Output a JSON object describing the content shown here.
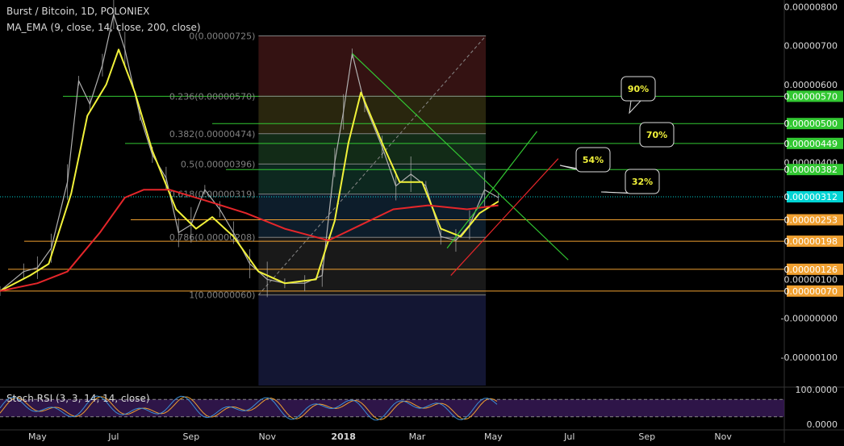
{
  "header": {
    "title": "Burst / Bitcoin, 1D, POLONIEX",
    "indicator": "MA_EMA (9, close, 14, close, 200, close)"
  },
  "rsi_label": "Stoch RSI (3, 3, 14, 14, close)",
  "colors": {
    "price": "#b0b0b0",
    "ema_fast": "#f2f23a",
    "ema_slow": "#e5262a",
    "fib_line": "#808080",
    "fib_text": "#808080",
    "price_tag": "#00d4d4",
    "green_level": "#32c832",
    "orange_level": "#f0a030",
    "callout_text": "#f2f23a",
    "rsi_k": "#3a8fd8",
    "rsi_d": "#f0a030",
    "rsi_band": "#3a1a5a"
  },
  "chart_data": {
    "type": "line",
    "title": "Burst / Bitcoin, 1D, POLONIEX",
    "x_axis_labels": [
      "May",
      "Jul",
      "Sep",
      "Nov",
      "2018",
      "Mar",
      "May",
      "Jul",
      "Sep",
      "Nov"
    ],
    "y_axis_labels": [
      "0.00000800",
      "0.00000700",
      "0.00000600",
      "0.00000400",
      "0.00000100",
      "-0.00000000",
      "-0.00000100"
    ],
    "ylim": [
      -1e-06,
      8.8e-06
    ],
    "last_price": "0.00000312",
    "price_series": [
      {
        "t": "2017-04-01",
        "v": 7e-07
      },
      {
        "t": "2017-04-20",
        "v": 1.2e-06
      },
      {
        "t": "2017-05-01",
        "v": 1.3e-06
      },
      {
        "t": "2017-05-12",
        "v": 1.8e-06
      },
      {
        "t": "2017-05-25",
        "v": 3.5e-06
      },
      {
        "t": "2017-06-03",
        "v": 6.1e-06
      },
      {
        "t": "2017-06-12",
        "v": 5.5e-06
      },
      {
        "t": "2017-06-22",
        "v": 6.5e-06
      },
      {
        "t": "2017-07-01",
        "v": 7.8e-06
      },
      {
        "t": "2017-07-10",
        "v": 6.9e-06
      },
      {
        "t": "2017-07-22",
        "v": 5.2e-06
      },
      {
        "t": "2017-08-01",
        "v": 4.2e-06
      },
      {
        "t": "2017-08-12",
        "v": 3.6e-06
      },
      {
        "t": "2017-08-22",
        "v": 2.2e-06
      },
      {
        "t": "2017-09-01",
        "v": 2.4e-06
      },
      {
        "t": "2017-09-12",
        "v": 3.3e-06
      },
      {
        "t": "2017-09-24",
        "v": 2.8e-06
      },
      {
        "t": "2017-10-05",
        "v": 2.2e-06
      },
      {
        "t": "2017-10-18",
        "v": 1.4e-06
      },
      {
        "t": "2017-11-01",
        "v": 1e-06
      },
      {
        "t": "2017-11-15",
        "v": 9e-07
      },
      {
        "t": "2017-12-01",
        "v": 9e-07
      },
      {
        "t": "2017-12-15",
        "v": 1.1e-06
      },
      {
        "t": "2017-12-25",
        "v": 4e-06
      },
      {
        "t": "2018-01-01",
        "v": 5.3e-06
      },
      {
        "t": "2018-01-08",
        "v": 6.8e-06
      },
      {
        "t": "2018-01-18",
        "v": 5.5e-06
      },
      {
        "t": "2018-02-01",
        "v": 4.4e-06
      },
      {
        "t": "2018-02-12",
        "v": 3.4e-06
      },
      {
        "t": "2018-02-24",
        "v": 3.7e-06
      },
      {
        "t": "2018-03-08",
        "v": 3.4e-06
      },
      {
        "t": "2018-03-20",
        "v": 2.1e-06
      },
      {
        "t": "2018-04-01",
        "v": 2e-06
      },
      {
        "t": "2018-04-12",
        "v": 2.4e-06
      },
      {
        "t": "2018-04-24",
        "v": 3.3e-06
      },
      {
        "t": "2018-05-05",
        "v": 3.1e-06
      }
    ],
    "ema_fast": [
      {
        "t": "2017-04-01",
        "v": 7e-07
      },
      {
        "t": "2017-04-25",
        "v": 1.1e-06
      },
      {
        "t": "2017-05-10",
        "v": 1.4e-06
      },
      {
        "t": "2017-05-28",
        "v": 3.2e-06
      },
      {
        "t": "2017-06-10",
        "v": 5.2e-06
      },
      {
        "t": "2017-06-25",
        "v": 6e-06
      },
      {
        "t": "2017-07-05",
        "v": 6.9e-06
      },
      {
        "t": "2017-07-18",
        "v": 5.8e-06
      },
      {
        "t": "2017-08-01",
        "v": 4.3e-06
      },
      {
        "t": "2017-08-20",
        "v": 2.8e-06
      },
      {
        "t": "2017-09-05",
        "v": 2.3e-06
      },
      {
        "t": "2017-09-18",
        "v": 2.6e-06
      },
      {
        "t": "2017-10-05",
        "v": 2.1e-06
      },
      {
        "t": "2017-10-25",
        "v": 1.2e-06
      },
      {
        "t": "2017-11-15",
        "v": 9e-07
      },
      {
        "t": "2017-12-10",
        "v": 1e-06
      },
      {
        "t": "2017-12-25",
        "v": 2.5e-06
      },
      {
        "t": "2018-01-05",
        "v": 4.5e-06
      },
      {
        "t": "2018-01-15",
        "v": 5.8e-06
      },
      {
        "t": "2018-02-01",
        "v": 4.5e-06
      },
      {
        "t": "2018-02-15",
        "v": 3.5e-06
      },
      {
        "t": "2018-03-05",
        "v": 3.5e-06
      },
      {
        "t": "2018-03-20",
        "v": 2.3e-06
      },
      {
        "t": "2018-04-05",
        "v": 2.1e-06
      },
      {
        "t": "2018-04-20",
        "v": 2.7e-06
      },
      {
        "t": "2018-05-05",
        "v": 3e-06
      }
    ],
    "ema_slow": [
      {
        "t": "2017-04-01",
        "v": 7e-07
      },
      {
        "t": "2017-05-01",
        "v": 9e-07
      },
      {
        "t": "2017-05-25",
        "v": 1.2e-06
      },
      {
        "t": "2017-06-20",
        "v": 2.2e-06
      },
      {
        "t": "2017-07-10",
        "v": 3.1e-06
      },
      {
        "t": "2017-07-25",
        "v": 3.3e-06
      },
      {
        "t": "2017-08-15",
        "v": 3.3e-06
      },
      {
        "t": "2017-09-15",
        "v": 3e-06
      },
      {
        "t": "2017-10-15",
        "v": 2.7e-06
      },
      {
        "t": "2017-11-15",
        "v": 2.3e-06
      },
      {
        "t": "2017-12-20",
        "v": 2e-06
      },
      {
        "t": "2018-01-15",
        "v": 2.4e-06
      },
      {
        "t": "2018-02-10",
        "v": 2.8e-06
      },
      {
        "t": "2018-03-10",
        "v": 2.9e-06
      },
      {
        "t": "2018-04-10",
        "v": 2.8e-06
      },
      {
        "t": "2018-05-05",
        "v": 2.9e-06
      }
    ],
    "fib_levels": [
      {
        "label": "0(0.00000725)",
        "value": 7.25e-06,
        "band": "#3a1414"
      },
      {
        "label": "0.236(0.00000570)",
        "value": 5.7e-06,
        "band": "#2d2a10"
      },
      {
        "label": "0.382(0.00000474)",
        "value": 4.74e-06,
        "band": "#14301a"
      },
      {
        "label": "0.5(0.00000396)",
        "value": 3.96e-06,
        "band": "#0e2c22"
      },
      {
        "label": "0.618(0.00000319)",
        "value": 3.19e-06,
        "band": "#0e2030"
      },
      {
        "label": "0.786(0.00000208)",
        "value": 2.08e-06,
        "band": "#1c1c1c"
      },
      {
        "label": "1(0.00000060)",
        "value": 6e-07,
        "band": "#151838"
      }
    ],
    "levels": [
      {
        "label": "0.00000570",
        "value": 5.7e-06,
        "kind": "green"
      },
      {
        "label": "0.00000500",
        "value": 5e-06,
        "kind": "green"
      },
      {
        "label": "0.00000449",
        "value": 4.49e-06,
        "kind": "green"
      },
      {
        "label": "0.00000382",
        "value": 3.82e-06,
        "kind": "green"
      },
      {
        "label": "0.00000253",
        "value": 2.53e-06,
        "kind": "orange"
      },
      {
        "label": "0.00000198",
        "value": 1.98e-06,
        "kind": "orange"
      },
      {
        "label": "0.00000126",
        "value": 1.26e-06,
        "kind": "orange"
      },
      {
        "label": "0.00000070",
        "value": 7e-07,
        "kind": "orange"
      }
    ],
    "callouts": [
      {
        "text": "90%",
        "level": 5.7e-06
      },
      {
        "text": "70%",
        "level": 5e-06
      },
      {
        "text": "54%",
        "level": 4.49e-06
      },
      {
        "text": "32%",
        "level": 3.82e-06
      }
    ],
    "rsi": {
      "label": "Stoch RSI (3, 3, 14, 14, close)",
      "y_axis_labels": [
        "100.0000",
        "0.0000"
      ],
      "upper_band": 80,
      "lower_band": 20
    }
  }
}
